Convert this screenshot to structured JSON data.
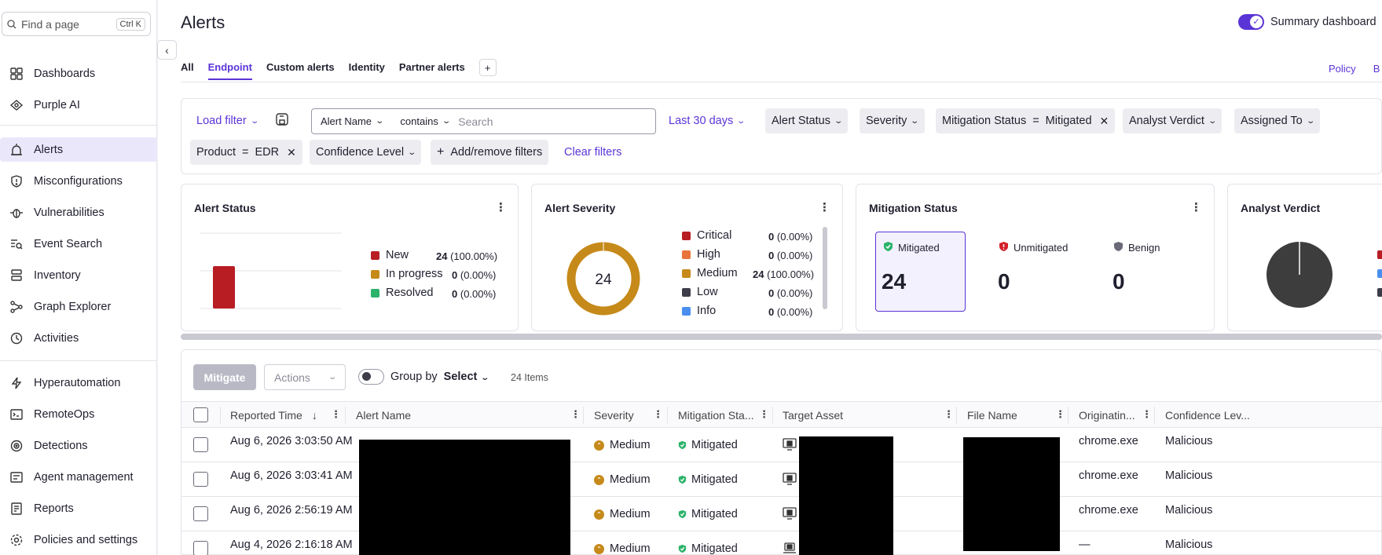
{
  "sidebar": {
    "search_placeholder": "Find a page",
    "search_shortcut": "Ctrl K",
    "items": [
      {
        "label": "Dashboards",
        "icon": "dashboard-grid-icon"
      },
      {
        "label": "Purple AI",
        "icon": "sparkle-icon"
      },
      {
        "label": "Alerts",
        "icon": "alarm-icon",
        "active": true
      },
      {
        "label": "Misconfigurations",
        "icon": "warning-shield-icon"
      },
      {
        "label": "Vulnerabilities",
        "icon": "bug-icon"
      },
      {
        "label": "Event Search",
        "icon": "search-list-icon"
      },
      {
        "label": "Inventory",
        "icon": "inventory-icon"
      },
      {
        "label": "Graph Explorer",
        "icon": "graph-icon"
      },
      {
        "label": "Activities",
        "icon": "history-icon"
      },
      {
        "label": "Hyperautomation",
        "icon": "lightning-icon"
      },
      {
        "label": "RemoteOps",
        "icon": "terminal-icon"
      },
      {
        "label": "Detections",
        "icon": "radar-icon"
      },
      {
        "label": "Agent management",
        "icon": "agent-icon"
      },
      {
        "label": "Reports",
        "icon": "report-icon"
      },
      {
        "label": "Policies and settings",
        "icon": "gear-icon"
      }
    ]
  },
  "header": {
    "title": "Alerts",
    "summary_toggle_label": "Summary dashboard",
    "right_links": [
      "Policy",
      "B"
    ]
  },
  "tabs": [
    {
      "label": "All"
    },
    {
      "label": "Endpoint",
      "active": true
    },
    {
      "label": "Custom alerts"
    },
    {
      "label": "Identity"
    },
    {
      "label": "Partner alerts"
    }
  ],
  "filters": {
    "load_filter": "Load filter",
    "search_field": "Alert Name",
    "search_operator": "contains",
    "search_placeholder": "Search",
    "date_range": "Last 30 days",
    "alert_status": "Alert Status",
    "severity": "Severity",
    "mitigation_key": "Mitigation Status",
    "mitigation_op": "=",
    "mitigation_value": "Mitigated",
    "analyst_verdict": "Analyst Verdict",
    "assigned_to": "Assigned To",
    "product_key": "Product",
    "product_op": "=",
    "product_value": "EDR",
    "confidence_level": "Confidence Level",
    "add_remove": "Add/remove filters",
    "clear": "Clear filters"
  },
  "cards": {
    "alert_status": {
      "title": "Alert Status",
      "legend": [
        {
          "label": "New",
          "count": "24",
          "pct": "(100.00%)",
          "color": "#b81d24"
        },
        {
          "label": "In progress",
          "count": "0",
          "pct": "(0.00%)",
          "color": "#c68a1a"
        },
        {
          "label": "Resolved",
          "count": "0",
          "pct": "(0.00%)",
          "color": "#2bb36a"
        }
      ],
      "bar_fraction": 1.0
    },
    "alert_severity": {
      "title": "Alert Severity",
      "center": "24",
      "legend": [
        {
          "label": "Critical",
          "count": "0",
          "pct": "(0.00%)",
          "color": "#b81d24"
        },
        {
          "label": "High",
          "count": "0",
          "pct": "(0.00%)",
          "color": "#e8743b"
        },
        {
          "label": "Medium",
          "count": "24",
          "pct": "(100.00%)",
          "color": "#c68a1a"
        },
        {
          "label": "Low",
          "count": "0",
          "pct": "(0.00%)",
          "color": "#3d3d4a"
        },
        {
          "label": "Info",
          "count": "0",
          "pct": "(0.00%)",
          "color": "#4a8ef0"
        }
      ]
    },
    "mitigation_status": {
      "title": "Mitigation Status",
      "items": [
        {
          "label": "Mitigated",
          "value": "24"
        },
        {
          "label": "Unmitigated",
          "value": "0"
        },
        {
          "label": "Benign",
          "value": "0"
        }
      ]
    },
    "analyst_verdict": {
      "title": "Analyst Verdict"
    }
  },
  "table_toolbar": {
    "mitigate": "Mitigate",
    "actions": "Actions",
    "group_by": "Group by",
    "group_select": "Select",
    "items_count": "24 Items"
  },
  "table": {
    "columns": [
      "Reported Time",
      "Alert Name",
      "Severity",
      "Mitigation Sta...",
      "Target Asset",
      "File Name",
      "Originatin...",
      "Confidence Lev..."
    ],
    "rows": [
      {
        "time": "Aug 6, 2026 3:03:50 AM",
        "severity": "Medium",
        "mitigation": "Mitigated",
        "origin": "chrome.exe",
        "confidence": "Malicious"
      },
      {
        "time": "Aug 6, 2026 3:03:41 AM",
        "severity": "Medium",
        "mitigation": "Mitigated",
        "origin": "chrome.exe",
        "confidence": "Malicious"
      },
      {
        "time": "Aug 6, 2026 2:56:19 AM",
        "severity": "Medium",
        "mitigation": "Mitigated",
        "origin": "chrome.exe",
        "confidence": "Malicious"
      },
      {
        "time": "Aug 4, 2026 2:16:18 AM",
        "severity": "Medium",
        "mitigation": "Mitigated",
        "origin": "—",
        "confidence": "Malicious"
      }
    ]
  },
  "colors": {
    "accent": "#5b34d6",
    "active_nav_bg": "#ebe7fb",
    "medium": "#c68a1a",
    "mitigated": "#2bb36a"
  }
}
